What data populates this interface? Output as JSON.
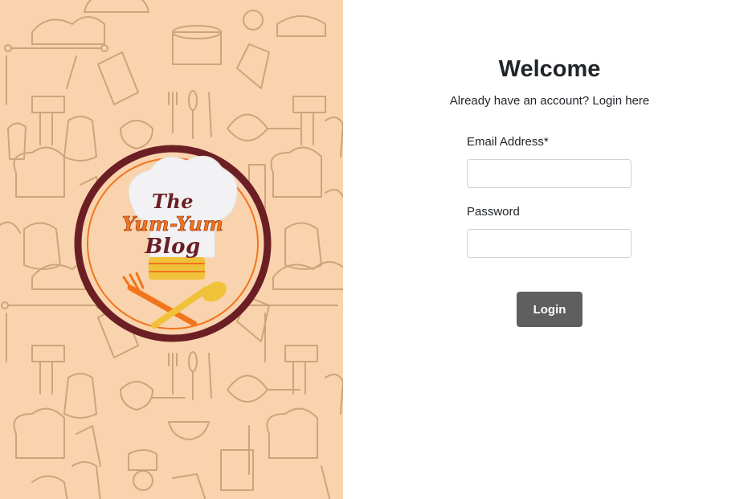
{
  "brand": {
    "logo_line1": "The",
    "logo_line2": "Yum-Yum",
    "logo_line3": "Blog",
    "pattern_background_color": "#f9d3ad",
    "pattern_ink_color": "#c89b72"
  },
  "login": {
    "title": "Welcome",
    "subtitle": "Already have an account? Login here",
    "email_label": "Email Address*",
    "email_value": "",
    "password_label": "Password",
    "password_value": "",
    "submit_label": "Login"
  },
  "colors": {
    "button": "#5f5f5f",
    "logo_ring": "#6b1f24",
    "logo_accent": "#f2741d",
    "logo_spoon": "#f0c23a"
  }
}
